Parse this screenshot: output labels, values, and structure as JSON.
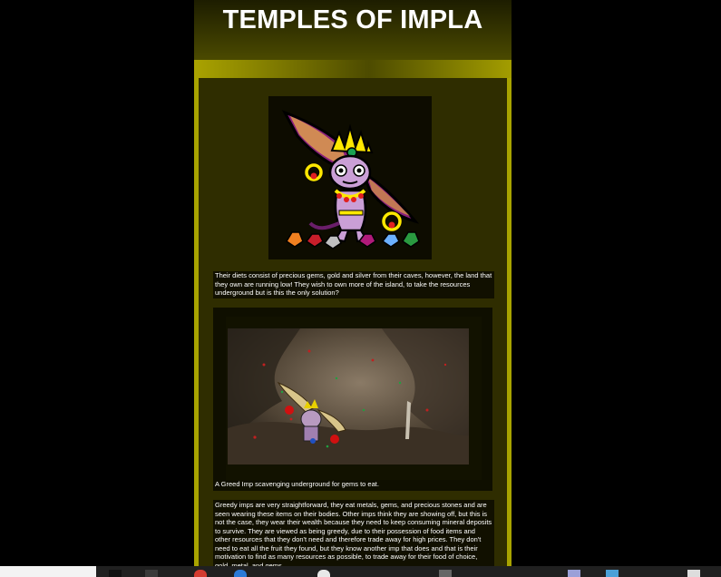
{
  "header": {
    "title": "TEMPLES OF IMPLA"
  },
  "captions": {
    "diet_text": "Their diets consist of precious gems, gold and silver from their caves, however, the land that they own are running low! They wish to own more of the island, to take the resources underground but is this the only solution?",
    "cave_caption": "A Greed Imp scavenging underground for gems to eat.",
    "greedy_text": "Greedy imps are very straightforward, they eat metals, gems, and precious stones and are seen wearing these items on their bodies. Other imps think they are showing off, but this is not the case, they wear their wealth because they need to keep consuming mineral deposits to survive. They are viewed as being greedy, due to their possession of food items and other resources that they don't need and therefore trade away for high prices. They don't need to eat all the fruit they found, but they know another imp that does and that is their motivation to find as many resources as possible, to trade away for their food of choice, gold, metal, and gems."
  },
  "colors": {
    "page_background": "#000000",
    "header_dark": "#1d1d00",
    "band_yellow": "#a8a300",
    "content_olive": "#2f2d00",
    "caption_bg": "#111000",
    "text": "#ffffff"
  },
  "icons": {
    "greed_imp_illustration": "greed-imp-image",
    "cave_scene": "cave-scene-image",
    "taskbar": [
      "start-icon",
      "app-icon",
      "chrome-icon",
      "edge-icon",
      "folder-icon",
      "settings-icon",
      "store-icon",
      "mail-icon",
      "network-icon"
    ]
  }
}
